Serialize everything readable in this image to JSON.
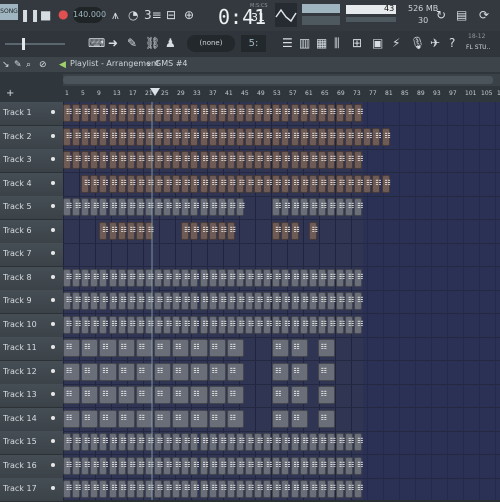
{
  "toolbar": {
    "song_label": "SONG",
    "tempo": "140.000",
    "time": "0:41",
    "time_sub": "31",
    "time_label": "M:S:CS",
    "cpu": "43",
    "memory": "526 MB",
    "voices": "30",
    "pattern_none": "(none)",
    "snap": "5:",
    "fl_label": "FL STU..",
    "fl_date": "18-12"
  },
  "playlist": {
    "title": "Playlist - Arrangement",
    "pattern": "GMS #4"
  },
  "ruler": {
    "ticks": [
      "1",
      "5",
      "9",
      "13",
      "17",
      "21",
      "25",
      "29",
      "33",
      "37",
      "41",
      "45",
      "49",
      "53",
      "57",
      "61",
      "65",
      "69",
      "73",
      "77",
      "81",
      "85",
      "89",
      "93",
      "97",
      "101",
      "105",
      "109"
    ]
  },
  "tracks": [
    "Track 1",
    "Track 2",
    "Track 3",
    "Track 4",
    "Track 5",
    "Track 6",
    "Track 7",
    "Track 8",
    "Track 9",
    "Track 10",
    "Track 11",
    "Track 12",
    "Track 13",
    "Track 14",
    "Track 15",
    "Track 16",
    "Track 17"
  ],
  "colors": {
    "grid_bg": "#2f3552",
    "brown": "#6f5b55",
    "grey": "#6a6e78",
    "accent": "#9bb9c6"
  }
}
